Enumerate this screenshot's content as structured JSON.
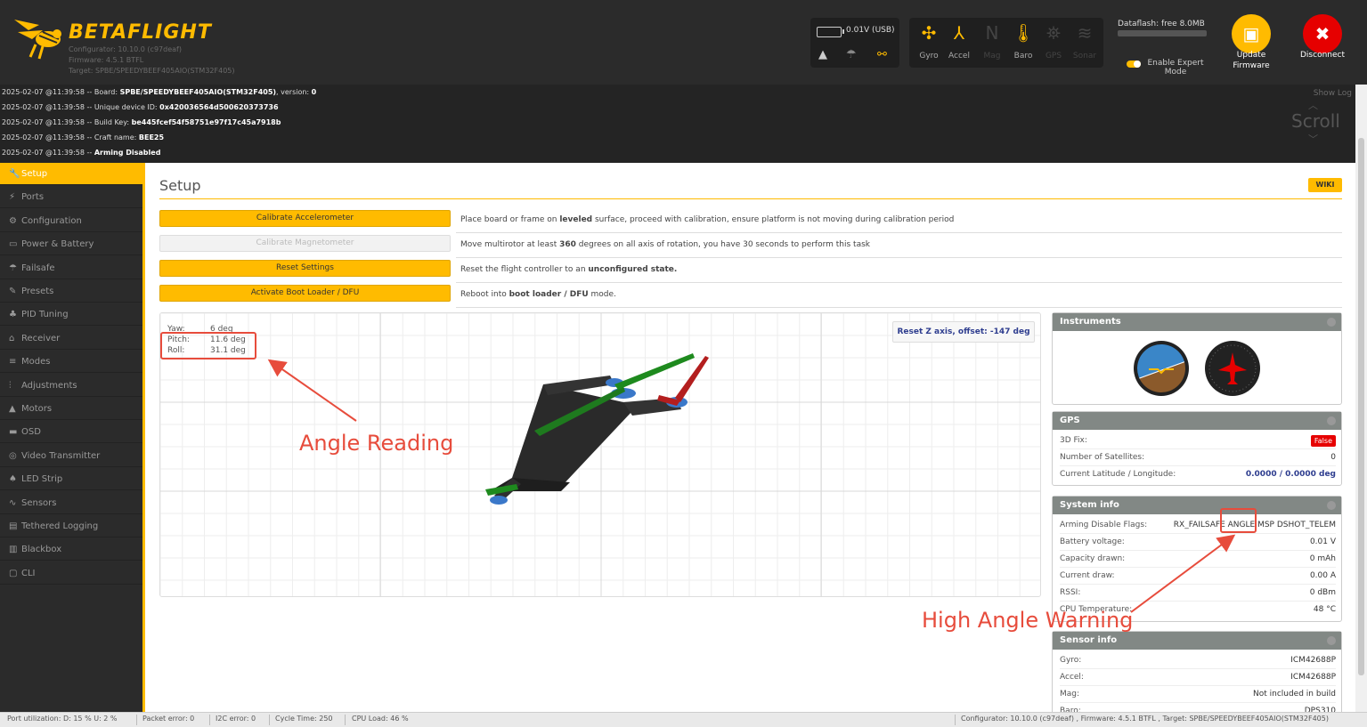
{
  "header": {
    "brand": "BETAFLIGHT",
    "configurator": "Configurator: 10.10.0 (c97deaf)",
    "firmware": "Firmware: 4.5.1 BTFL",
    "target": "Target: SPBE/SPEEDYBEEF405AIO(STM32F405)",
    "battery": "0.01V (USB)",
    "sensors": [
      {
        "label": "Gyro",
        "icon": "gyro-icon",
        "active": true
      },
      {
        "label": "Accel",
        "icon": "accel-icon",
        "active": true
      },
      {
        "label": "Mag",
        "icon": "mag-icon",
        "active": false
      },
      {
        "label": "Baro",
        "icon": "baro-icon",
        "active": true
      },
      {
        "label": "GPS",
        "icon": "gps-icon",
        "active": false
      },
      {
        "label": "Sonar",
        "icon": "sonar-icon",
        "active": false
      }
    ],
    "dataflash": "Dataflash: free 8.0MB",
    "expert_mode": "Enable Expert Mode",
    "update_firmware": "Update Firmware",
    "disconnect": "Disconnect"
  },
  "log": {
    "lines": [
      {
        "prefix": "2025-02-07 @11:39:58 -- Board: ",
        "bold": "SPBE/SPEEDYBEEF405AIO(STM32F405)",
        "suffix": ", version: ",
        "bold2": "0"
      },
      {
        "prefix": "2025-02-07 @11:39:58 -- Unique device ID: ",
        "bold": "0x420036564d500620373736",
        "suffix": "",
        "bold2": ""
      },
      {
        "prefix": "2025-02-07 @11:39:58 -- Build Key: ",
        "bold": "be445fcef54f58751e97f17c45a7918b",
        "suffix": "",
        "bold2": ""
      },
      {
        "prefix": "2025-02-07 @11:39:58 -- Craft name: ",
        "bold": "BEE25",
        "suffix": "",
        "bold2": ""
      },
      {
        "prefix": "2025-02-07 @11:39:58 -- ",
        "bold": "Arming Disabled",
        "suffix": "",
        "bold2": ""
      }
    ],
    "show_log": "Show Log",
    "scroll": "Scroll"
  },
  "sidebar": {
    "items": [
      {
        "label": "Setup",
        "icon": "wrench-icon",
        "glyph": "🔧",
        "active": true
      },
      {
        "label": "Ports",
        "icon": "ports-icon",
        "glyph": "⚡",
        "active": false
      },
      {
        "label": "Configuration",
        "icon": "gear-icon",
        "glyph": "⚙",
        "active": false
      },
      {
        "label": "Power & Battery",
        "icon": "battery-icon",
        "glyph": "▭",
        "active": false
      },
      {
        "label": "Failsafe",
        "icon": "parachute-icon",
        "glyph": "☂",
        "active": false
      },
      {
        "label": "Presets",
        "icon": "presets-icon",
        "glyph": "✎",
        "active": false
      },
      {
        "label": "PID Tuning",
        "icon": "pid-icon",
        "glyph": "♣",
        "active": false
      },
      {
        "label": "Receiver",
        "icon": "receiver-icon",
        "glyph": "⌂",
        "active": false
      },
      {
        "label": "Modes",
        "icon": "modes-icon",
        "glyph": "≡",
        "active": false
      },
      {
        "label": "Adjustments",
        "icon": "adjustments-icon",
        "glyph": "⫶",
        "active": false
      },
      {
        "label": "Motors",
        "icon": "motors-icon",
        "glyph": "▲",
        "active": false
      },
      {
        "label": "OSD",
        "icon": "osd-icon",
        "glyph": "▬",
        "active": false
      },
      {
        "label": "Video Transmitter",
        "icon": "vtx-icon",
        "glyph": "◎",
        "active": false
      },
      {
        "label": "LED Strip",
        "icon": "led-icon",
        "glyph": "♠",
        "active": false
      },
      {
        "label": "Sensors",
        "icon": "sensors-icon",
        "glyph": "∿",
        "active": false
      },
      {
        "label": "Tethered Logging",
        "icon": "tethered-icon",
        "glyph": "▤",
        "active": false
      },
      {
        "label": "Blackbox",
        "icon": "blackbox-icon",
        "glyph": "▥",
        "active": false
      },
      {
        "label": "CLI",
        "icon": "cli-icon",
        "glyph": "▢",
        "active": false
      }
    ]
  },
  "main": {
    "title": "Setup",
    "wiki": "WIKI",
    "actions": [
      {
        "label": "Calibrate Accelerometer",
        "disabled": false,
        "desc_pre": "Place board or frame on ",
        "desc_bold": "leveled",
        "desc_post": " surface, proceed with calibration, ensure platform is not moving during calibration period"
      },
      {
        "label": "Calibrate Magnetometer",
        "disabled": true,
        "desc_pre": "Move multirotor at least ",
        "desc_bold": "360",
        "desc_post": " degrees on all axis of rotation, you have 30 seconds to perform this task"
      },
      {
        "label": "Reset Settings",
        "disabled": false,
        "desc_pre": "Reset the flight controller to an ",
        "desc_bold": "unconfigured state.",
        "desc_post": ""
      },
      {
        "label": "Activate Boot Loader / DFU",
        "disabled": false,
        "desc_pre": "Reboot into ",
        "desc_bold": "boot loader / DFU",
        "desc_post": " mode."
      }
    ],
    "attitude": {
      "yaw_label": "Yaw:",
      "yaw": "6 deg",
      "pitch_label": "Pitch:",
      "pitch": "11.6 deg",
      "roll_label": "Roll:",
      "roll": "31.1 deg"
    },
    "reset_z": "Reset Z axis, offset: -147 deg"
  },
  "panels": {
    "instruments": {
      "title": "Instruments"
    },
    "gps": {
      "title": "GPS",
      "rows": [
        {
          "key": "3D Fix:",
          "value": "False"
        },
        {
          "key": "Number of Satellites:",
          "value": "0"
        },
        {
          "key": "Current Latitude / Longitude:",
          "value": "0.0000 / 0.0000 deg"
        }
      ]
    },
    "system": {
      "title": "System info",
      "rows": [
        {
          "key": "Arming Disable Flags:",
          "value": "RX_FAILSAFE ANGLE MSP DSHOT_TELEM"
        },
        {
          "key": "Battery voltage:",
          "value": "0.01 V"
        },
        {
          "key": "Capacity drawn:",
          "value": "0 mAh"
        },
        {
          "key": "Current draw:",
          "value": "0.00 A"
        },
        {
          "key": "RSSI:",
          "value": "0 dBm"
        },
        {
          "key": "CPU Temperature:",
          "value": "48 °C"
        }
      ]
    },
    "sensor": {
      "title": "Sensor info",
      "rows": [
        {
          "key": "Gyro:",
          "value": "ICM42688P"
        },
        {
          "key": "Accel:",
          "value": "ICM42688P"
        },
        {
          "key": "Mag:",
          "value": "Not included in build"
        },
        {
          "key": "Baro:",
          "value": "DPS310"
        }
      ]
    }
  },
  "status_bar": {
    "port_util": "Port utilization: D: 15 % U: 2 %",
    "packet_error": "Packet error: 0",
    "i2c_error": "I2C error: 0",
    "cycle_time": "Cycle Time: 250",
    "cpu_load": "CPU Load: 46 %",
    "version": "Configurator: 10.10.0 (c97deaf) , Firmware: 4.5.1 BTFL , Target: SPBE/SPEEDYBEEF405AIO(STM32F405)"
  },
  "annotations": {
    "angle_reading": "Angle Reading",
    "high_angle_warning": "High Angle Warning"
  },
  "colors": {
    "accent": "#ffbb00",
    "header_bg": "#2b2b2b",
    "annotation": "#e74c3c",
    "link": "#2e3d8f"
  }
}
